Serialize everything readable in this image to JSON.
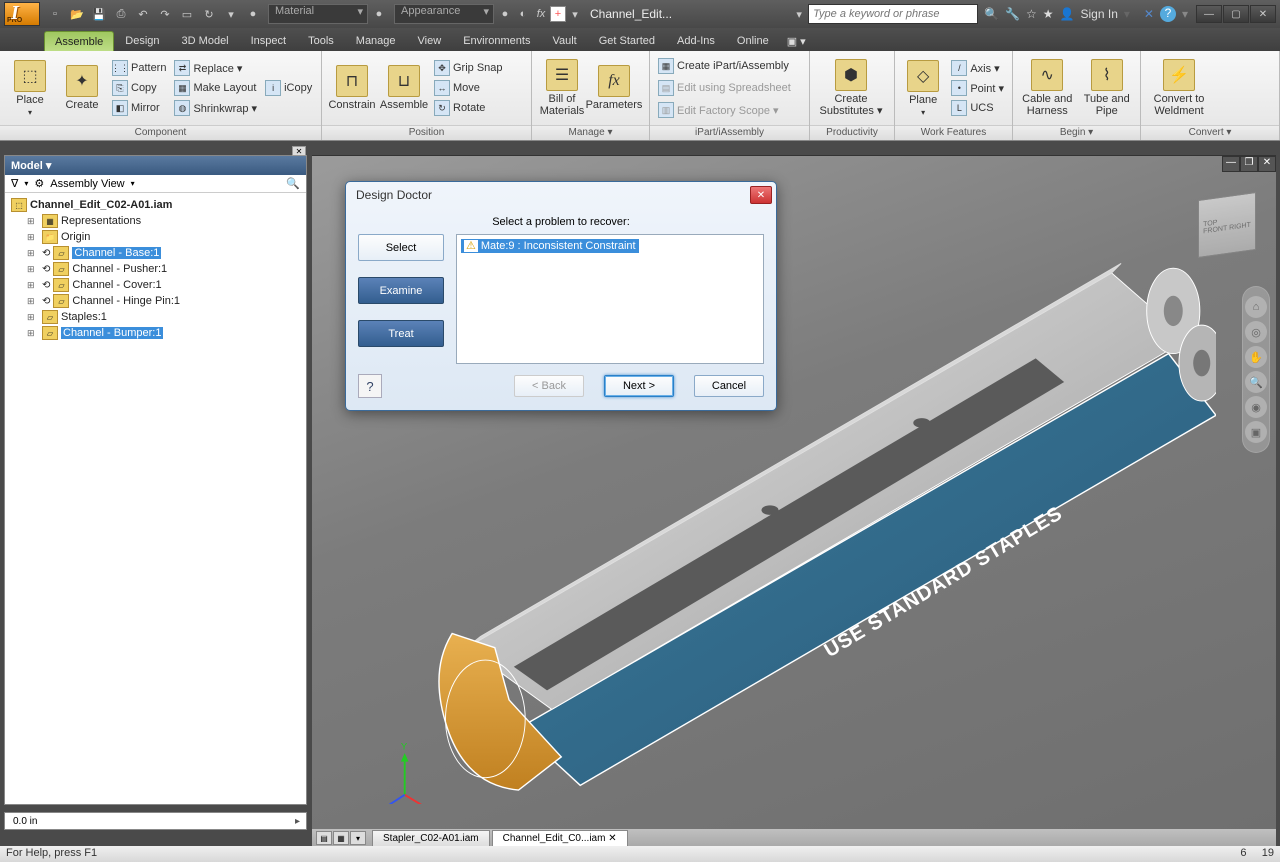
{
  "app": {
    "pro_label": "PRO",
    "doc_title": "Channel_Edit...",
    "material_ph": "Material",
    "appearance_ph": "Appearance",
    "search_ph": "Type a keyword or phrase",
    "signin": "Sign In"
  },
  "qat": [
    "new",
    "open",
    "save",
    "print",
    "undo",
    "redo",
    "sep",
    "select",
    "sep",
    "help"
  ],
  "tabs": [
    "Assemble",
    "Design",
    "3D Model",
    "Inspect",
    "Tools",
    "Manage",
    "View",
    "Environments",
    "Vault",
    "Get Started",
    "Add-Ins",
    "Online"
  ],
  "active_tab": "Assemble",
  "ribbon": {
    "component": {
      "label": "Component",
      "place": "Place",
      "create": "Create",
      "items": [
        [
          "Pattern",
          "Replace ▾",
          "iCopy"
        ],
        [
          "Copy",
          "Make Layout",
          ""
        ],
        [
          "Mirror",
          "Shrinkwrap ▾",
          ""
        ]
      ]
    },
    "position": {
      "label": "Position",
      "constrain": "Constrain",
      "assemble": "Assemble",
      "items": [
        "Grip Snap",
        "Move",
        "Rotate"
      ]
    },
    "manage": {
      "label": "Manage ▾",
      "bom": "Bill of\nMaterials",
      "params": "Parameters"
    },
    "ipart": {
      "label": "iPart/iAssembly",
      "items": [
        "Create iPart/iAssembly",
        "Edit using Spreadsheet",
        "Edit Factory Scope ▾"
      ]
    },
    "prod": {
      "label": "Productivity",
      "btn": "Create\nSubstitutes ▾"
    },
    "workfeat": {
      "label": "Work Features",
      "plane": "Plane",
      "items": [
        "Axis ▾",
        "Point ▾",
        "UCS"
      ]
    },
    "begin": {
      "label": "Begin ▾",
      "cable": "Cable and\nHarness",
      "tube": "Tube and\nPipe"
    },
    "convert": {
      "label": "Convert ▾",
      "btn": "Convert to\nWeldment"
    }
  },
  "model": {
    "title": "Model ▾",
    "view": "Assembly View",
    "root": "Channel_Edit_C02-A01.iam",
    "items": [
      "Representations",
      "Origin",
      "Channel - Base:1",
      "Channel - Pusher:1",
      "Channel - Cover:1",
      "Channel - Hinge Pin:1",
      "Staples:1",
      "Channel - Bumper:1"
    ],
    "selected": [
      2,
      7
    ]
  },
  "dialog": {
    "title": "Design Doctor",
    "prompt": "Select a problem to recover:",
    "select": "Select",
    "examine": "Examine",
    "treat": "Treat",
    "problem": "Mate:9 : Inconsistent Constraint",
    "back": "< Back",
    "next": "Next >",
    "cancel": "Cancel"
  },
  "surface_text": "USE STANDARD STAPLES",
  "doc_tabs": [
    "Stapler_C02-A01.iam",
    "Channel_Edit_C0...iam ✕"
  ],
  "status": {
    "help": "For Help, press F1",
    "n1": "6",
    "n2": "19"
  },
  "ruler": "0.0 in"
}
